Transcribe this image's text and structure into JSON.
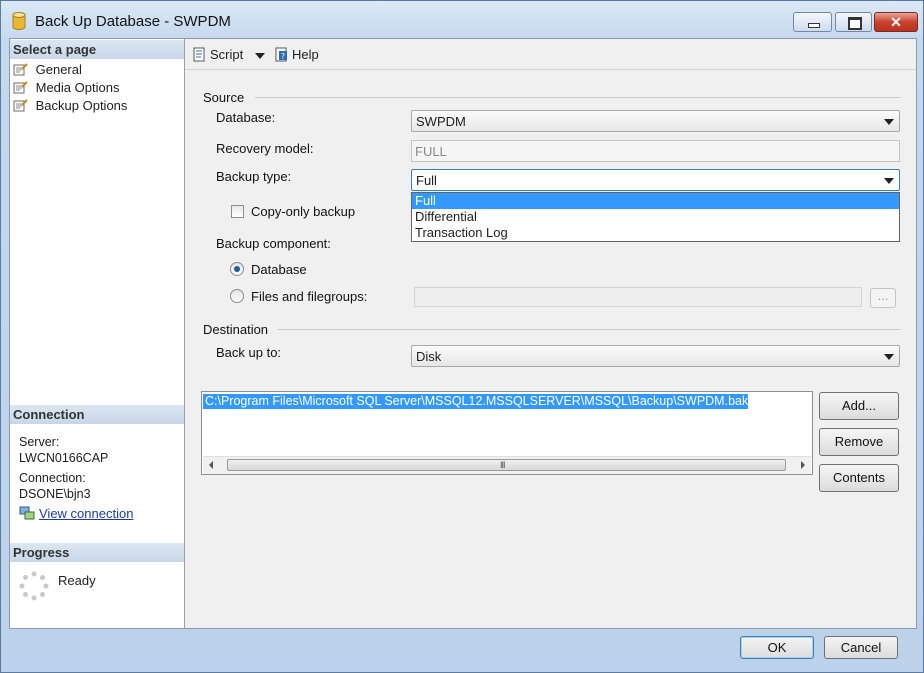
{
  "window": {
    "title": "Back Up Database - SWPDM"
  },
  "left_pane": {
    "select_page_header": "Select a page",
    "pages": [
      {
        "label": "General"
      },
      {
        "label": "Media Options"
      },
      {
        "label": "Backup Options"
      }
    ],
    "connection_header": "Connection",
    "server_label": "Server:",
    "server_value": "LWCN0166CAP",
    "connection_label": "Connection:",
    "connection_value": "DSONE\\bjn3",
    "view_connection_link": "View connection",
    "progress_header": "Progress",
    "progress_status": "Ready"
  },
  "toolbar": {
    "script_label": "Script",
    "help_label": "Help"
  },
  "source": {
    "group_label": "Source",
    "database_label": "Database:",
    "database_value": "SWPDM",
    "recovery_model_label": "Recovery model:",
    "recovery_model_value": "FULL",
    "backup_type_label": "Backup type:",
    "backup_type_value": "Full",
    "backup_type_options": [
      "Full",
      "Differential",
      "Transaction Log"
    ],
    "backup_type_selected_index": 0,
    "copy_only_label": "Copy-only backup",
    "copy_only_checked": false,
    "backup_component_label": "Backup component:",
    "component_database_label": "Database",
    "component_files_label": "Files and filegroups:",
    "component_selected": "Database",
    "browse_label": "..."
  },
  "destination": {
    "group_label": "Destination",
    "back_up_to_label": "Back up to:",
    "back_up_to_value": "Disk",
    "paths": [
      "C:\\Program Files\\Microsoft SQL Server\\MSSQL12.MSSQLSERVER\\MSSQL\\Backup\\SWPDM.bak"
    ],
    "add_label": "Add...",
    "remove_label": "Remove",
    "contents_label": "Contents",
    "scroll_grip": "III"
  },
  "footer": {
    "ok_label": "OK",
    "cancel_label": "Cancel"
  },
  "colors": {
    "selection": "#3399ff",
    "pane_header": "#c8d7e8",
    "link": "#1c3d9c",
    "close_button": "#c9432e"
  }
}
